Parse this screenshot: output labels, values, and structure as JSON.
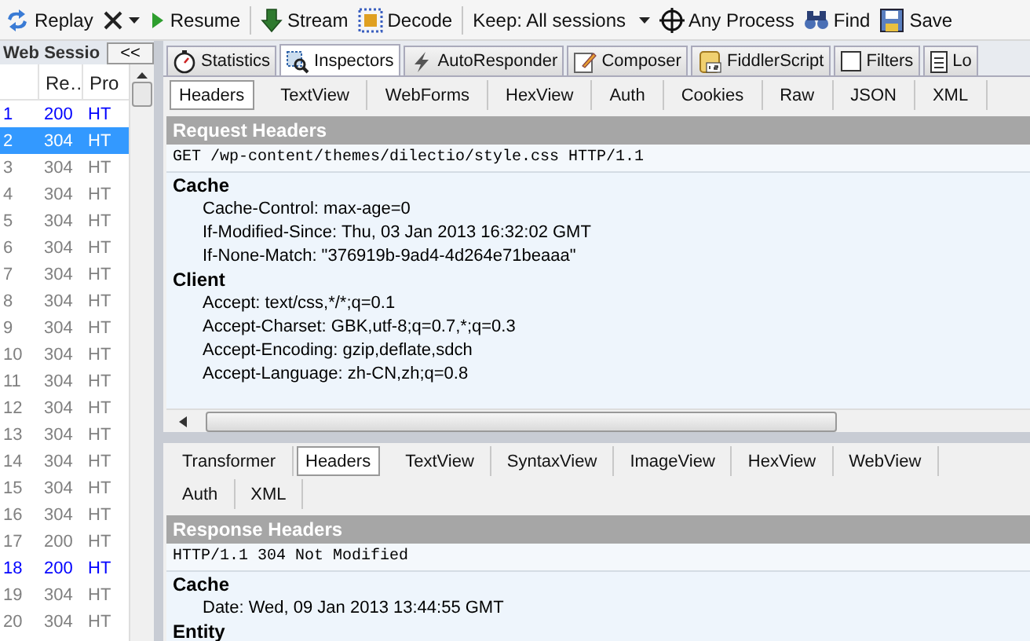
{
  "toolbar": {
    "items": [
      {
        "kind": "button",
        "label": "Replay"
      },
      {
        "kind": "icon-menu"
      },
      {
        "kind": "button",
        "label": "Resume"
      },
      {
        "kind": "separator"
      },
      {
        "kind": "button",
        "label": "Stream"
      },
      {
        "kind": "button",
        "label": "Decode"
      },
      {
        "kind": "separator"
      },
      {
        "kind": "dropdown",
        "label": "Keep: All sessions"
      },
      {
        "kind": "button",
        "label": "Any Process"
      },
      {
        "kind": "button",
        "label": "Find"
      },
      {
        "kind": "button",
        "label": "Save"
      }
    ]
  },
  "sessions": {
    "title": "Web Sessio",
    "collapse_button": "<<",
    "columns": [
      "Re…",
      "Pro"
    ],
    "rows": [
      {
        "number": "1",
        "result": "200",
        "protocol": "HT",
        "color": "#0000ff",
        "selected": false
      },
      {
        "number": "2",
        "result": "304",
        "protocol": "HT",
        "selected": true
      },
      {
        "number": "3",
        "result": "304",
        "protocol": "HT",
        "color": "#808080",
        "selected": false
      },
      {
        "number": "4",
        "result": "304",
        "protocol": "HT",
        "color": "#808080",
        "selected": false
      },
      {
        "number": "5",
        "result": "304",
        "protocol": "HT",
        "color": "#808080",
        "selected": false
      },
      {
        "number": "6",
        "result": "304",
        "protocol": "HT",
        "color": "#808080",
        "selected": false
      },
      {
        "number": "7",
        "result": "304",
        "protocol": "HT",
        "color": "#808080",
        "selected": false
      },
      {
        "number": "8",
        "result": "304",
        "protocol": "HT",
        "color": "#808080",
        "selected": false
      },
      {
        "number": "9",
        "result": "304",
        "protocol": "HT",
        "color": "#808080",
        "selected": false
      },
      {
        "number": "10",
        "result": "304",
        "protocol": "HT",
        "color": "#808080",
        "selected": false
      },
      {
        "number": "11",
        "result": "304",
        "protocol": "HT",
        "color": "#808080",
        "selected": false
      },
      {
        "number": "12",
        "result": "304",
        "protocol": "HT",
        "color": "#808080",
        "selected": false
      },
      {
        "number": "13",
        "result": "304",
        "protocol": "HT",
        "color": "#808080",
        "selected": false
      },
      {
        "number": "14",
        "result": "304",
        "protocol": "HT",
        "color": "#808080",
        "selected": false
      },
      {
        "number": "15",
        "result": "304",
        "protocol": "HT",
        "color": "#808080",
        "selected": false
      },
      {
        "number": "16",
        "result": "304",
        "protocol": "HT",
        "color": "#808080",
        "selected": false
      },
      {
        "number": "17",
        "result": "200",
        "protocol": "HT",
        "color": "#808080",
        "selected": false
      },
      {
        "number": "18",
        "result": "200",
        "protocol": "HT",
        "color": "#0000ff",
        "selected": false
      },
      {
        "number": "19",
        "result": "304",
        "protocol": "HT",
        "color": "#808080",
        "selected": false
      },
      {
        "number": "20",
        "result": "304",
        "protocol": "HT",
        "color": "#808080",
        "selected": false
      }
    ]
  },
  "tabs": [
    {
      "label": "Statistics",
      "selected": false
    },
    {
      "label": "Inspectors",
      "selected": true
    },
    {
      "label": "AutoResponder",
      "selected": false
    },
    {
      "label": "Composer",
      "selected": false
    },
    {
      "label": "FiddlerScript",
      "selected": false
    },
    {
      "label": "Filters",
      "selected": false
    },
    {
      "label": "Lo",
      "selected": false
    }
  ],
  "request": {
    "tabs": [
      {
        "label": "Headers",
        "selected": true
      },
      {
        "label": "TextView",
        "selected": false
      },
      {
        "label": "WebForms",
        "selected": false
      },
      {
        "label": "HexView",
        "selected": false
      },
      {
        "label": "Auth",
        "selected": false
      },
      {
        "label": "Cookies",
        "selected": false
      },
      {
        "label": "Raw",
        "selected": false
      },
      {
        "label": "JSON",
        "selected": false
      },
      {
        "label": "XML",
        "selected": false
      }
    ],
    "title": "Request Headers",
    "request_line": "GET /wp-content/themes/dilectio/style.css HTTP/1.1",
    "groups": [
      {
        "name": "Cache",
        "headers": [
          "Cache-Control: max-age=0",
          "If-Modified-Since: Thu, 03 Jan 2013 16:32:02 GMT",
          "If-None-Match: \"376919b-9ad4-4d264e71beaaa\""
        ]
      },
      {
        "name": "Client",
        "headers": [
          "Accept: text/css,*/*;q=0.1",
          "Accept-Charset: GBK,utf-8;q=0.7,*;q=0.3",
          "Accept-Encoding: gzip,deflate,sdch",
          "Accept-Language: zh-CN,zh;q=0.8"
        ]
      }
    ]
  },
  "response": {
    "tabs": [
      {
        "label": "Transformer",
        "selected": false
      },
      {
        "label": "Headers",
        "selected": true
      },
      {
        "label": "TextView",
        "selected": false
      },
      {
        "label": "SyntaxView",
        "selected": false
      },
      {
        "label": "ImageView",
        "selected": false
      },
      {
        "label": "HexView",
        "selected": false
      },
      {
        "label": "WebView",
        "selected": false
      },
      {
        "label": "Auth",
        "selected": false
      },
      {
        "label": "XML",
        "selected": false
      }
    ],
    "title": "Response Headers",
    "status_line": "HTTP/1.1 304 Not Modified",
    "groups": [
      {
        "name": "Cache",
        "headers": [
          "Date: Wed, 09 Jan 2013 13:44:55 GMT"
        ]
      },
      {
        "name": "Entity"
      }
    ]
  }
}
